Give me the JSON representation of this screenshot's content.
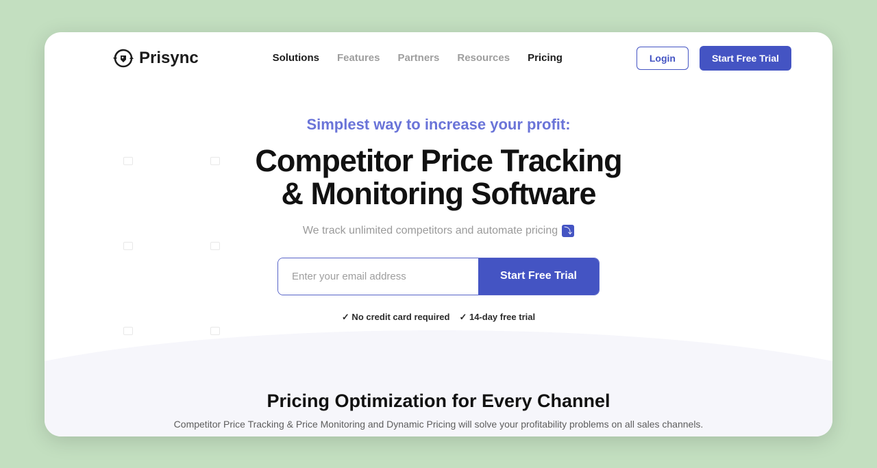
{
  "brand": {
    "name": "Prisync"
  },
  "nav": {
    "items": [
      {
        "label": "Solutions",
        "active": true
      },
      {
        "label": "Features"
      },
      {
        "label": "Partners"
      },
      {
        "label": "Resources"
      },
      {
        "label": "Pricing",
        "dark": true
      }
    ],
    "login": "Login",
    "cta": "Start Free Trial"
  },
  "hero": {
    "kicker": "Simplest way to increase your profit:",
    "title_l1": "Competitor Price Tracking",
    "title_l2": "& Monitoring Software",
    "sub": "We track unlimited competitors and automate pricing",
    "email_placeholder": "Enter your email address",
    "submit": "Start Free Trial",
    "bullet1": "✓ No credit card required",
    "bullet2": "✓ 14-day free trial"
  },
  "section2": {
    "title": "Pricing Optimization for Every Channel",
    "sub": "Competitor Price Tracking & Price Monitoring and Dynamic Pricing will solve your profitability problems on all sales channels."
  },
  "colors": {
    "accent": "#4454c3"
  }
}
